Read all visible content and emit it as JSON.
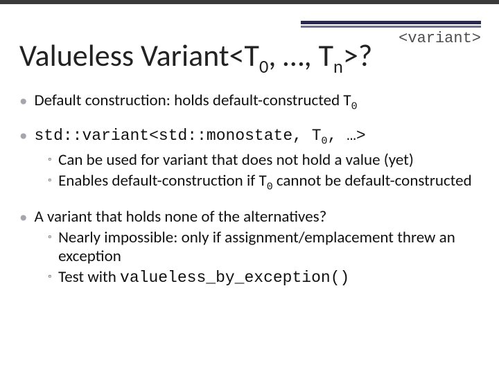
{
  "header": {
    "tag": "<variant>"
  },
  "title": {
    "pre": "Valueless Variant<T",
    "sub1": "0",
    "mid": ", …, T",
    "sub2": "n",
    "post": ">?"
  },
  "b1": {
    "pre": "Default construction: holds default-constructed T",
    "sub": "0"
  },
  "b2": {
    "code_pre": "std::variant<std::monostate, T",
    "code_sub": "0",
    "code_post": ", …>",
    "s1": "Can be used for variant that does not hold a value (yet)",
    "s2_pre": "Enables default-construction if T",
    "s2_sub": "0",
    "s2_post": " cannot be default-constructed"
  },
  "b3": {
    "text": "A variant that holds none of the alternatives?",
    "s1": "Nearly impossible: only if assignment/emplacement threw an exception",
    "s2_pre": "Test with ",
    "s2_code": "valueless_by_exception()"
  }
}
